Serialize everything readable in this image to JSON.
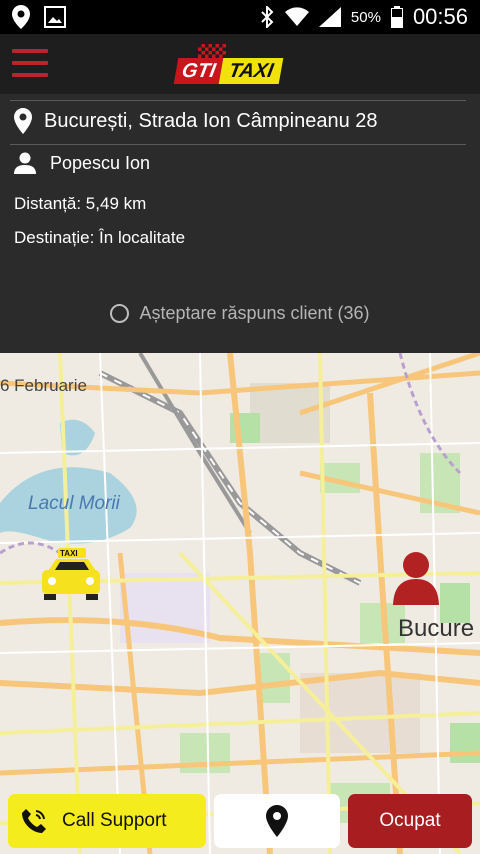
{
  "status_bar": {
    "battery": "50%",
    "time": "00:56",
    "icons": [
      "location-icon",
      "image-icon",
      "bluetooth-icon",
      "wifi-icon",
      "signal-icon",
      "battery-icon"
    ]
  },
  "header": {
    "logo_gti": "GTI",
    "logo_taxi": "TAXI",
    "menu_icon": "hamburger-menu-icon"
  },
  "order": {
    "address": "București, Strada Ion Câmpineanu 28",
    "client_name": "Popescu Ion",
    "distance": "Distanță: 5,49 km",
    "destination": "Destinație: În localitate",
    "status": "Așteptare răspuns client (36)"
  },
  "map": {
    "labels": {
      "street": "6 Februarie",
      "lake": "Lacul Morii",
      "city": "Bucure",
      "taxi_sign": "TAXI"
    }
  },
  "actions": {
    "support_label": "Call Support",
    "busy_label": "Ocupat"
  },
  "colors": {
    "accent_red": "#a81d1f",
    "accent_yellow": "#f5ec1e",
    "panel_bg": "#2b2b2b"
  }
}
